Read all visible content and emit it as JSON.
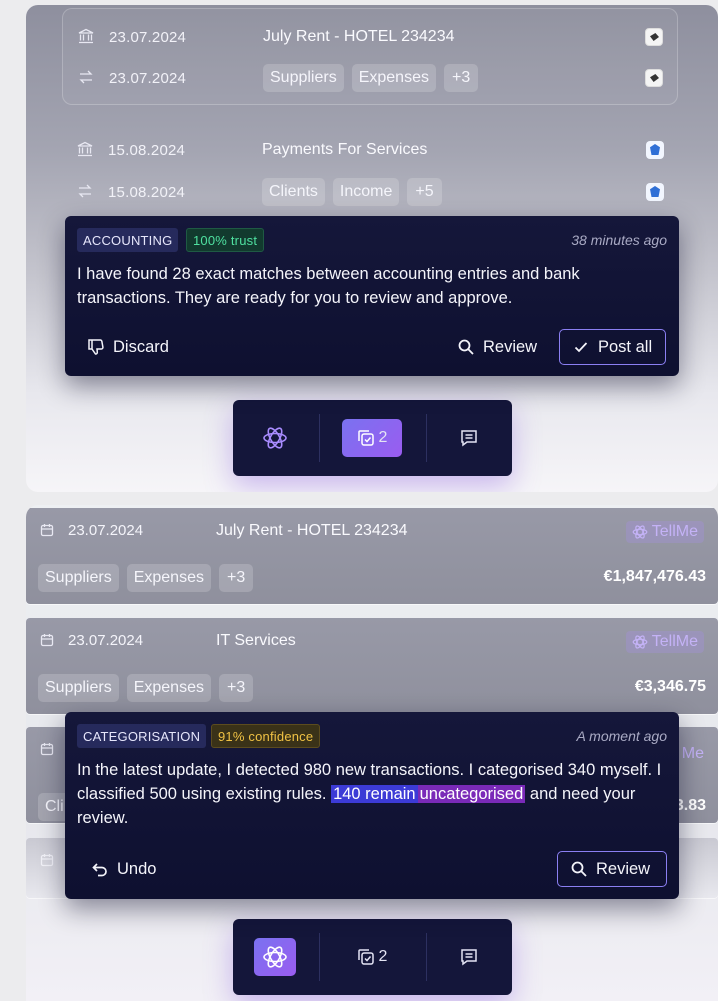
{
  "panel1": {
    "transactions": [
      {
        "bank_date": "23.07.2024",
        "description": "July Rent - HOTEL 234234",
        "transfer_date": "23.07.2024",
        "tags": [
          "Suppliers",
          "Expenses",
          "+3"
        ],
        "bank_icon": "bank-icon",
        "transfer_icon": "transfer-arrows-icon",
        "logo": "dark-bank-logo"
      },
      {
        "bank_date": "15.08.2024",
        "description": "Payments For Services",
        "transfer_date": "15.08.2024",
        "tags": [
          "Clients",
          "Income",
          "+5"
        ],
        "bank_icon": "bank-icon",
        "transfer_icon": "transfer-arrows-icon",
        "logo": "blue-bank-logo"
      }
    ],
    "card": {
      "category": "ACCOUNTING",
      "badge": "100% trust",
      "time": "38 minutes ago",
      "message": "I have found 28 exact matches between accounting entries and bank transactions. They are ready for you to review and approve.",
      "discard_label": "Discard",
      "review_label": "Review",
      "post_all_label": "Post all"
    },
    "toolbar": {
      "task_count": "2",
      "active": "tasks"
    }
  },
  "panel2": {
    "rows": [
      {
        "date": "23.07.2024",
        "description": "July Rent - HOTEL 234234",
        "tellme": "TellMe",
        "tags": [
          "Suppliers",
          "Expenses",
          "+3"
        ],
        "amount": "€1,847,476.43"
      },
      {
        "date": "23.07.2024",
        "description": "IT Services",
        "tellme": "TellMe",
        "tags": [
          "Suppliers",
          "Expenses",
          "+3"
        ],
        "amount": "€3,346.75"
      }
    ],
    "partial_row": {
      "tag_fragment": "Cli",
      "tellme_fragment": "Me",
      "amount_fragment": "3.83"
    },
    "card": {
      "category": "CATEGORISATION",
      "badge": "91% confidence",
      "time": "A moment ago",
      "message_before": "In the latest update, I detected 980 new transactions. I categorised 340 myself. I classified 500 using existing rules.",
      "message_highlight_a": "140 remain",
      "message_highlight_b": "uncategorised",
      "message_after": "and need your review.",
      "undo_label": "Undo",
      "review_label": "Review"
    },
    "toolbar": {
      "task_count": "2",
      "active": "assistant"
    }
  },
  "colors": {
    "card_bg": "#15173a",
    "accent_purple": "#8b7ff2",
    "trust_green": "#4fe0a0",
    "confidence_amber": "#f0c244",
    "highlight_blue": "#3c3bd6",
    "highlight_purple": "#7a2ab8"
  }
}
